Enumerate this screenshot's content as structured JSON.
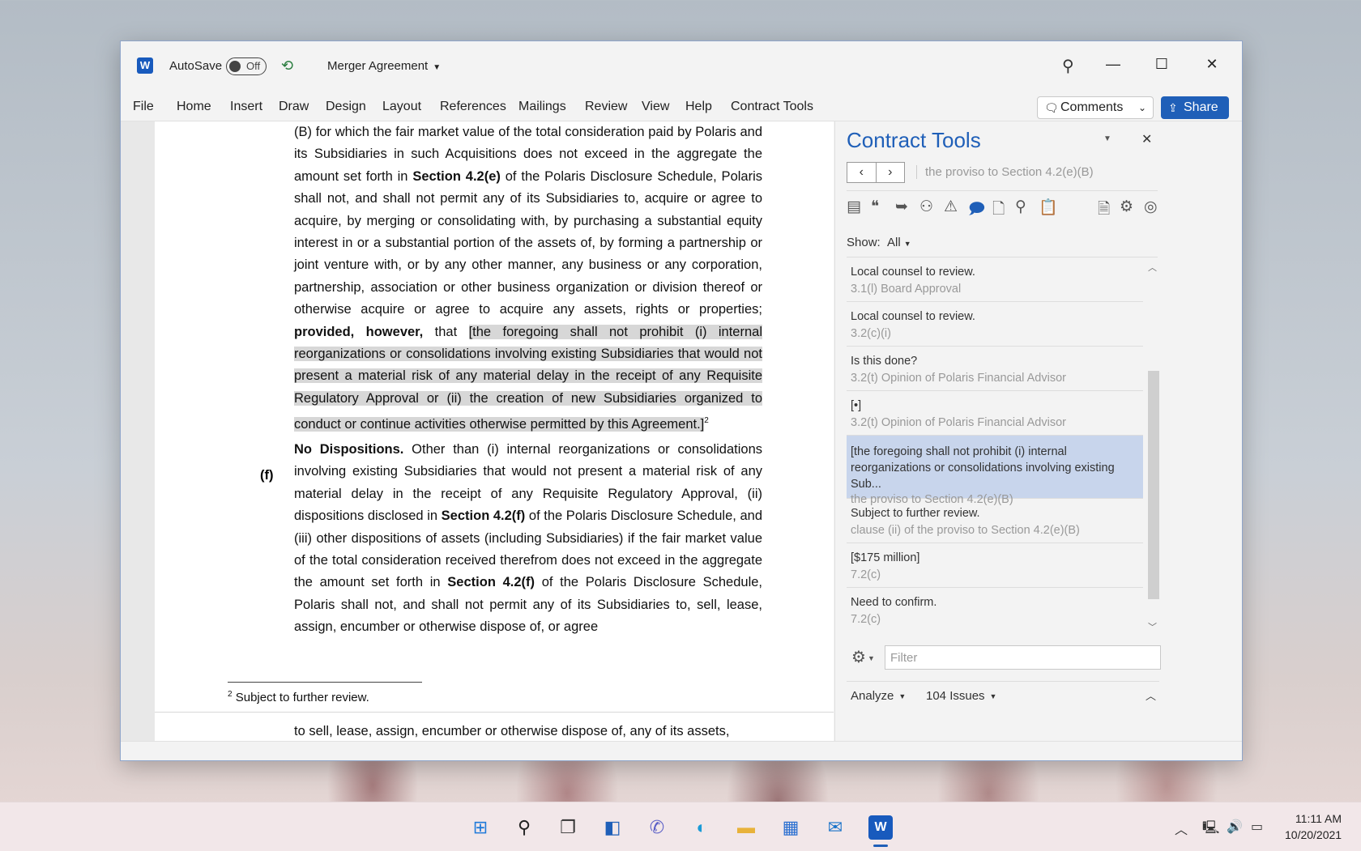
{
  "titlebar": {
    "app_icon_letter": "W",
    "autosave_label": "AutoSave",
    "autosave_state": "Off",
    "document_title": "Merger Agreement"
  },
  "ribbon": {
    "tabs": [
      "File",
      "Home",
      "Insert",
      "Draw",
      "Design",
      "Layout",
      "References",
      "Mailings",
      "Review",
      "View",
      "Help",
      "Contract Tools"
    ],
    "comments_label": "Comments",
    "share_label": "Share"
  },
  "document": {
    "para1_a": "(B) for which the fair market value of the total consideration paid by Polaris and its Subsidiaries in such Acquisitions does not exceed in the aggregate the amount set forth in ",
    "para1_section": "Section 4.2(e)",
    "para1_b": " of the Polaris Disclosure Schedule, Polaris shall not, and shall not permit any of its Subsidiaries to, acquire or agree to acquire, by merging or consolidating with, by purchasing a substantial equity interest in or a substantial portion of the assets of, by forming a partnership or joint venture with, or by any other manner, any business or any corporation, partnership, association or other business organization or division thereof or otherwise acquire or agree to acquire any assets, rights or properties; ",
    "para1_proviso": "provided, however,",
    "para1_c": " that ",
    "para1_highlight": "[the foregoing shall not prohibit (i) internal reorganizations or consolidations involving existing Subsidiaries that would not present a material risk of any material delay in the receipt of any Requisite Regulatory Approval or (ii) the creation of new Subsidiaries organized to conduct or continue activities otherwise permitted by this Agreement.]",
    "para1_footnote_ref": "2",
    "para2_label": "(f)",
    "para2_heading": "No Dispositions.",
    "para2_a": " Other than (i) internal reorganizations or consolidations involving existing Subsidiaries that would not present a material risk of any material delay in the receipt of any Requisite Regulatory Approval, (ii) dispositions disclosed in ",
    "para2_section1": "Section 4.2(f)",
    "para2_b": " of the Polaris Disclosure Schedule, and (iii) other dispositions of assets (including Subsidiaries) if the fair market value of the total consideration received therefrom does not exceed in the aggregate the amount set forth in ",
    "para2_section2": "Section 4.2(f)",
    "para2_c": " of the Polaris Disclosure Schedule, Polaris shall not, and shall not permit any of its Subsidiaries to, sell, lease, assign, encumber or otherwise dispose of, or agree",
    "footnote_number": "2",
    "footnote_text": " Subject to further review.",
    "next_page_text": "to sell, lease, assign, encumber or otherwise dispose of, any of its assets,"
  },
  "pane": {
    "title": "Contract Tools",
    "nav_context": "the proviso to Section 4.2(e)(B)",
    "show_label": "Show:",
    "show_value": "All",
    "issues": [
      {
        "text": "Local counsel to review.",
        "ref": "3.1(l) Board Approval",
        "selected": false
      },
      {
        "text": "Local counsel to review.",
        "ref": "3.2(c)(i)",
        "selected": false
      },
      {
        "text": "Is this done?",
        "ref": "3.2(t) Opinion of Polaris Financial Advisor",
        "selected": false
      },
      {
        "text": "[•]",
        "ref": "3.2(t) Opinion of Polaris Financial Advisor",
        "selected": false
      },
      {
        "text": "[the foregoing shall not prohibit (i) internal reorganizations or consolidations involving existing Sub...",
        "ref": "the proviso to Section 4.2(e)(B)",
        "selected": true
      },
      {
        "text": "Subject to further review.",
        "ref": "clause (ii) of the proviso to Section 4.2(e)(B)",
        "selected": false
      },
      {
        "text": "[$175 million]",
        "ref": "7.2(c)",
        "selected": false
      },
      {
        "text": "Need to confirm.",
        "ref": "7.2(c)",
        "selected": false
      }
    ],
    "filter_placeholder": "Filter",
    "analyze_label": "Analyze",
    "issues_count_label": "104 Issues"
  },
  "taskbar": {
    "time": "11:11 AM",
    "date": "10/20/2021"
  },
  "colors": {
    "accent": "#1f5fb8",
    "selected_row": "#c8d5ec",
    "highlight": "#d7d7d7"
  }
}
